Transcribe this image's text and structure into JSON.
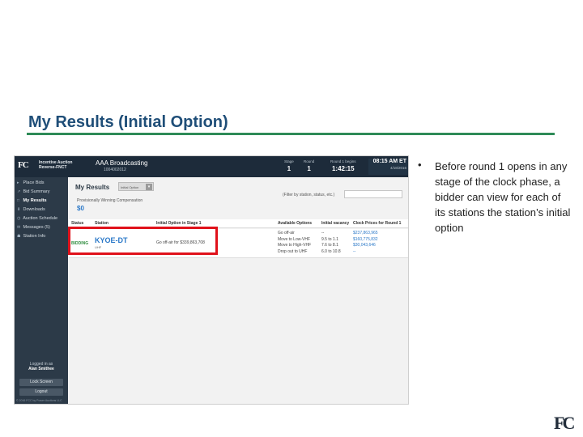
{
  "slide": {
    "title": "My Results (Initial Option)",
    "bullet": "Before round 1 opens in any stage of the clock phase, a bidder can view for each of its stations the station’s initial option"
  },
  "app": {
    "logo": "FC",
    "name": "Incentive Auction Reverse-FNCT",
    "bidder_name": "AAA Broadcasting",
    "bidder_id": "1004002012",
    "stage_label": "Stage",
    "stage_value": "1",
    "round_label": "Round",
    "round_value": "1",
    "round_begins_label": "Round 1 begins",
    "round_begins_value": "1:42:15",
    "clock_time": "08:15 AM ET",
    "clock_date": "4/18/2016"
  },
  "sidebar": {
    "items": [
      {
        "icon": "▸",
        "label": "Place Bids"
      },
      {
        "icon": "↗",
        "label": "Bid Summary"
      },
      {
        "icon": "□",
        "label": "My Results"
      },
      {
        "icon": "⬇",
        "label": "Downloads"
      },
      {
        "icon": "◷",
        "label": "Auction Schedule"
      },
      {
        "icon": "✉",
        "label": "Messages (5)"
      },
      {
        "icon": "☗",
        "label": "Station Info"
      }
    ],
    "logged_in_label": "Logged in as",
    "user": "Alan Smithee",
    "lock_label": "Lock Screen",
    "logout_label": "Logout",
    "copyright": "© 2016 FCC by Power Auctions LLC"
  },
  "results": {
    "title": "My Results",
    "selector": "Initial Option",
    "prov_label": "Provisionally Winning Compensation",
    "prov_value": "$0",
    "filter_label": "(Filter by station, status, etc.)",
    "columns": [
      "Status",
      "Station",
      "Initial Option in Stage 1",
      "Available Options",
      "Initial vacancy",
      "Clock Prices for Round 1"
    ],
    "row": {
      "status": "BIDDING",
      "callsign": "KYOE-DT",
      "band": "UHF",
      "initial_option": "Go off-air for $339,863,708",
      "options": [
        "Go off-air",
        "Move to Low-VHF",
        "Move to High-VHF",
        "Drop out to UHF"
      ],
      "vacancies": [
        "--",
        "9.5 to 1.1",
        "7.6 to 8.1",
        "6.0 to 10.8"
      ],
      "prices": [
        "$237,863,965",
        "$160,775,832",
        "$30,043,646",
        "--"
      ]
    }
  },
  "footer_logo": "FC"
}
